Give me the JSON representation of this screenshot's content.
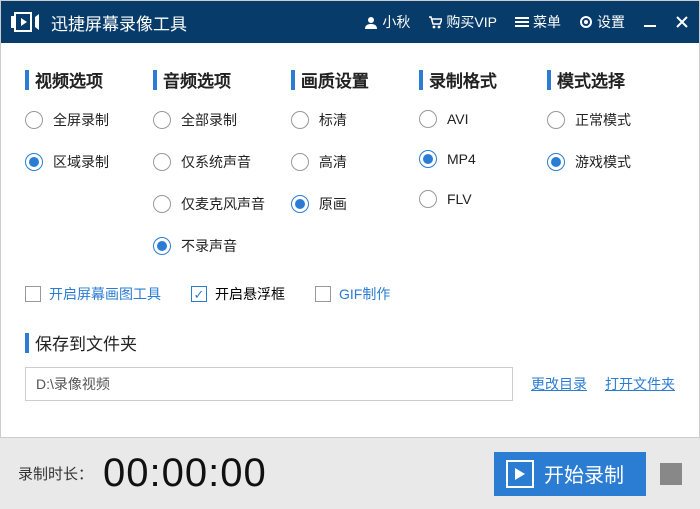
{
  "titlebar": {
    "app_title": "迅捷屏幕录像工具",
    "user": "小秋",
    "vip": "购买VIP",
    "menu": "菜单",
    "settings": "设置"
  },
  "options": {
    "video": {
      "header": "视频选项",
      "items": [
        "全屏录制",
        "区域录制"
      ],
      "selected": 1
    },
    "audio": {
      "header": "音频选项",
      "items": [
        "全部录制",
        "仅系统声音",
        "仅麦克风声音",
        "不录声音"
      ],
      "selected": 3
    },
    "quality": {
      "header": "画质设置",
      "items": [
        "标清",
        "高清",
        "原画"
      ],
      "selected": 2
    },
    "format": {
      "header": "录制格式",
      "items": [
        "AVI",
        "MP4",
        "FLV"
      ],
      "selected": 1
    },
    "mode": {
      "header": "模式选择",
      "items": [
        "正常模式",
        "游戏模式"
      ],
      "selected": 1
    }
  },
  "checkboxes": {
    "draw": {
      "label": "开启屏幕画图工具",
      "checked": false
    },
    "float": {
      "label": "开启悬浮框",
      "checked": true
    },
    "gif": {
      "label": "GIF制作",
      "checked": false
    }
  },
  "save": {
    "header": "保存到文件夹",
    "path": "D:\\录像视频",
    "change": "更改目录",
    "open": "打开文件夹"
  },
  "footer": {
    "dur_label": "录制时长：",
    "timer": "00:00:00",
    "start": "开始录制"
  }
}
